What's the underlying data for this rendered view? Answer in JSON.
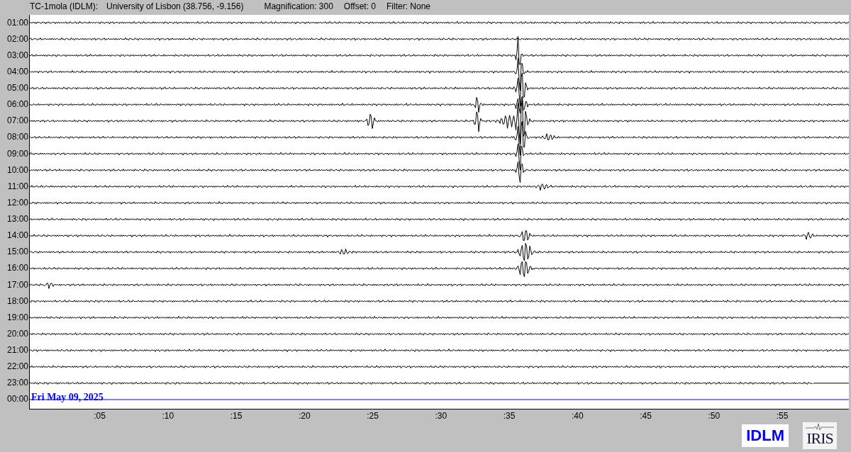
{
  "header": {
    "station": "TC-1mola (IDLM):",
    "location": "University of Lisbon (38.756, -9.156)",
    "magnification": "Magnification: 300",
    "offset": "Offset: 0",
    "filter": "Filter: None"
  },
  "rows": [
    {
      "label": "01:00",
      "kind": "trace"
    },
    {
      "label": "02:00",
      "kind": "trace"
    },
    {
      "label": "03:00",
      "kind": "trace"
    },
    {
      "label": "04:00",
      "kind": "trace"
    },
    {
      "label": "05:00",
      "kind": "trace"
    },
    {
      "label": "06:00",
      "kind": "trace"
    },
    {
      "label": "07:00",
      "kind": "trace"
    },
    {
      "label": "08:00",
      "kind": "trace"
    },
    {
      "label": "09:00",
      "kind": "trace"
    },
    {
      "label": "10:00",
      "kind": "trace"
    },
    {
      "label": "11:00",
      "kind": "trace"
    },
    {
      "label": "12:00",
      "kind": "trace"
    },
    {
      "label": "13:00",
      "kind": "trace"
    },
    {
      "label": "14:00",
      "kind": "trace"
    },
    {
      "label": "15:00",
      "kind": "trace"
    },
    {
      "label": "16:00",
      "kind": "trace"
    },
    {
      "label": "17:00",
      "kind": "trace"
    },
    {
      "label": "18:00",
      "kind": "trace"
    },
    {
      "label": "19:00",
      "kind": "trace"
    },
    {
      "label": "20:00",
      "kind": "trace"
    },
    {
      "label": "21:00",
      "kind": "trace"
    },
    {
      "label": "22:00",
      "kind": "trace"
    },
    {
      "label": "23:00",
      "kind": "partial"
    },
    {
      "label": "00:00",
      "kind": "date",
      "date": "Fri May 09, 2025"
    }
  ],
  "x_ticks": [
    ":05",
    ":10",
    ":15",
    ":20",
    ":25",
    ":30",
    ":35",
    ":40",
    ":45",
    ":50",
    ":55"
  ],
  "logos": {
    "network": "IDLM",
    "provider": "IRIS"
  }
}
